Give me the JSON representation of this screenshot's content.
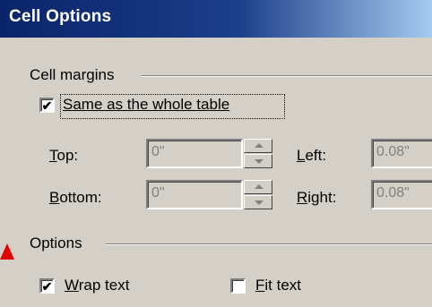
{
  "window": {
    "title": "Cell Options"
  },
  "cell_margins": {
    "group_label": "Cell margins",
    "same_as_table": {
      "label": "Same as the whole table",
      "checked": true,
      "check_glyph": "✔"
    },
    "top": {
      "label_underlined": "T",
      "label_rest": "op:",
      "value": "0\""
    },
    "left": {
      "label_underlined": "L",
      "label_rest": "eft:",
      "value": "0.08\""
    },
    "bottom": {
      "label_underlined": "B",
      "label_rest": "ottom:",
      "value": "0\""
    },
    "right": {
      "label_underlined": "R",
      "label_rest": "ight:",
      "value": "0.08\""
    }
  },
  "options": {
    "group_label": "Options",
    "wrap_text": {
      "label_underlined": "W",
      "label_rest": "rap text",
      "checked": true,
      "check_glyph": "✔"
    },
    "fit_text": {
      "label_underlined": "F",
      "label_rest": "it text",
      "checked": false,
      "check_glyph": ""
    }
  },
  "colors": {
    "title_bar_start": "#0a246a",
    "title_bar_end": "#a6caf0",
    "dialog_face": "#d4d0c8",
    "disabled_text": "#808080",
    "pointer_arrow": "#e00000"
  }
}
